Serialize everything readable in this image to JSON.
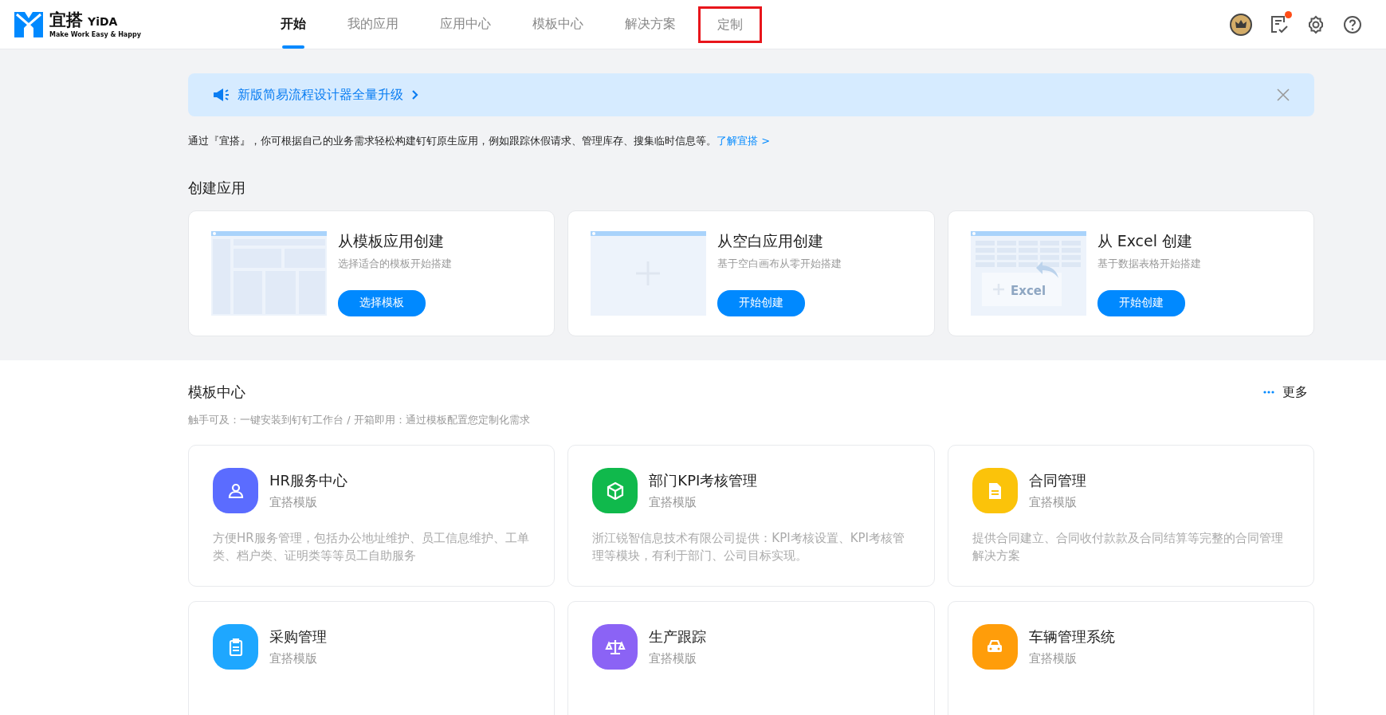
{
  "logo": {
    "name": "宜搭",
    "brand": "YiDA",
    "slogan": "Make Work Easy & Happy"
  },
  "nav": [
    {
      "label": "开始",
      "selected": true,
      "highlighted": false
    },
    {
      "label": "我的应用",
      "selected": false,
      "highlighted": false
    },
    {
      "label": "应用中心",
      "selected": false,
      "highlighted": false
    },
    {
      "label": "模板中心",
      "selected": false,
      "highlighted": false
    },
    {
      "label": "解决方案",
      "selected": false,
      "highlighted": false
    },
    {
      "label": "定制",
      "selected": false,
      "highlighted": true
    }
  ],
  "header": {
    "todo_badge": true
  },
  "banner": {
    "text": "新版简易流程设计器全量升级"
  },
  "intro": {
    "text": "通过『宜搭』，你可根据自己的业务需求轻松构建钉钉原生应用，例如跟踪休假请求、管理库存、搜集临时信息等。",
    "link": "了解宜搭 >"
  },
  "create": {
    "title": "创建应用",
    "cards": [
      {
        "kind": "template",
        "title": "从模板应用创建",
        "subtitle": "选择适合的模板开始搭建",
        "button": "选择模板"
      },
      {
        "kind": "blank",
        "title": "从空白应用创建",
        "subtitle": "基于空白画布从零开始搭建",
        "button": "开始创建"
      },
      {
        "kind": "excel",
        "title": "从 Excel 创建",
        "subtitle": "基于数据表格开始搭建",
        "button": "开始创建",
        "art_label": "Excel"
      }
    ]
  },
  "templates": {
    "title": "模板中心",
    "more": "更多",
    "subtitle": "触手可及：一键安装到钉钉工作台 / 开箱即用：通过模板配置您定制化需求",
    "items": [
      {
        "kind": "person",
        "color": "#5b6cff",
        "name": "HR服务中心",
        "source": "宜搭模版",
        "description": "方便HR服务管理，包括办公地址维护、员工信息维护、工单类、档户类、证明类等等员工自助服务"
      },
      {
        "kind": "cube",
        "color": "#10b94c",
        "name": "部门KPI考核管理",
        "source": "宜搭模版",
        "description": "浙江锐智信息技术有限公司提供：KPI考核设置、KPI考核管理等模块，有利于部门、公司目标实现。"
      },
      {
        "kind": "document",
        "color": "#fbc30a",
        "name": "合同管理",
        "source": "宜搭模版",
        "description": "提供合同建立、合同收付款款及合同结算等完整的合同管理解决方案"
      },
      {
        "kind": "clipboard",
        "color": "#1ea7ff",
        "name": "采购管理",
        "source": "宜搭模版"
      },
      {
        "kind": "scale",
        "color": "#8b63f5",
        "name": "生产跟踪",
        "source": "宜搭模版"
      },
      {
        "kind": "car",
        "color": "#ff9d0a",
        "name": "车辆管理系统",
        "source": "宜搭模版"
      }
    ]
  }
}
